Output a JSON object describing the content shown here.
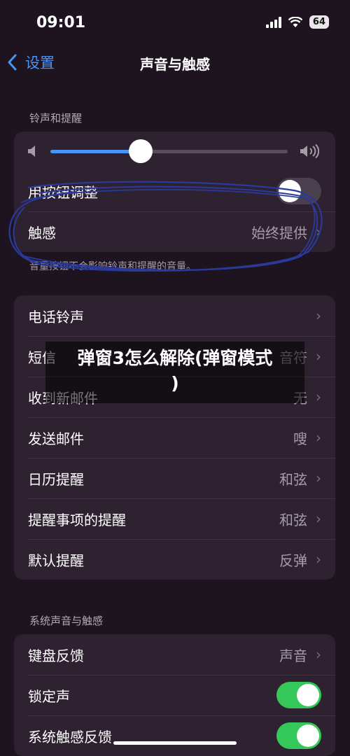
{
  "status": {
    "time": "09:01",
    "battery": "64"
  },
  "nav": {
    "back_label": "设置",
    "title": "声音与触感"
  },
  "ringer": {
    "section_label": "铃声和提醒",
    "volume_level": 0.38,
    "adjust_with_buttons_label": "用按钮调整",
    "adjust_with_buttons_on": false,
    "haptics_label": "触感",
    "haptics_value": "始终提供",
    "footnote": "音量按钮不会影响铃声和提醒的音量。"
  },
  "sounds": [
    {
      "label": "电话铃声",
      "value": ""
    },
    {
      "label": "短信",
      "value": "音符"
    },
    {
      "label": "收到新邮件",
      "value": "无"
    },
    {
      "label": "发送邮件",
      "value": "嗖"
    },
    {
      "label": "日历提醒",
      "value": "和弦"
    },
    {
      "label": "提醒事项的提醒",
      "value": "和弦"
    },
    {
      "label": "默认提醒",
      "value": "反弹"
    }
  ],
  "system": {
    "section_label": "系统声音与触感",
    "keyboard_feedback_label": "键盘反馈",
    "keyboard_feedback_value": "声音",
    "lock_sound_label": "锁定声",
    "lock_sound_on": true,
    "system_haptics_label": "系统触感反馈",
    "system_haptics_on": true
  },
  "overlay": {
    "title_line1": "弹窗3怎么解除(弹窗模式",
    "title_line2": ")"
  },
  "colors": {
    "accent": "#4a93f5",
    "toggle_on": "#34c759",
    "scribble": "#2a3a9a"
  }
}
